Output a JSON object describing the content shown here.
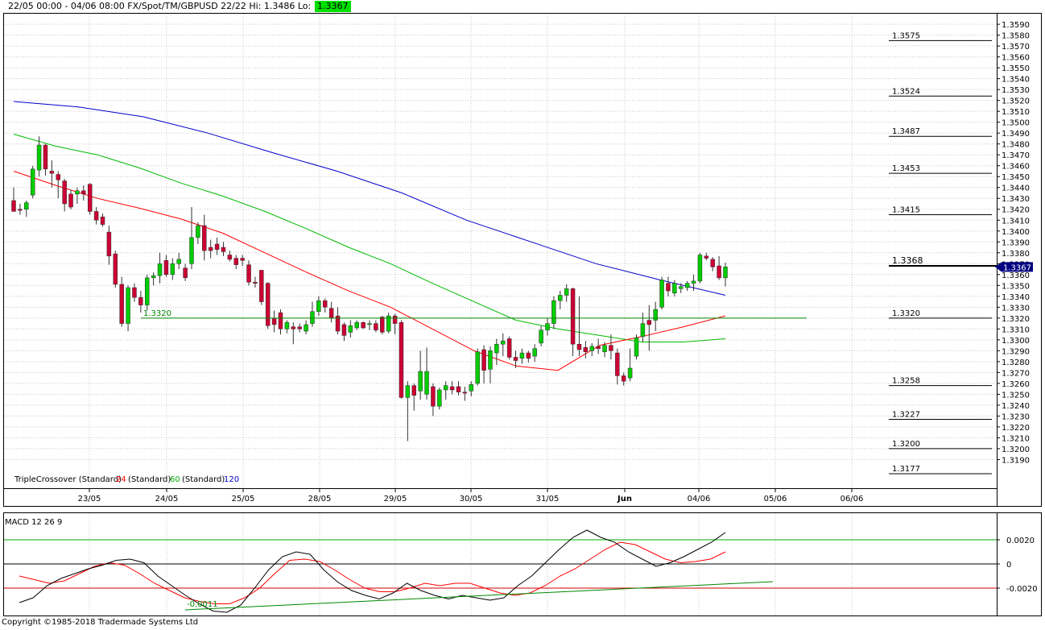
{
  "header": {
    "title": "22/05 00:00 - 04/06 08:00  FX/Spot/TM/GBPUSD 22/22  Hi: 1.3486  Lo: 1.3207",
    "last_price": "1.3367"
  },
  "copyright": "Copyright ©1985-2018 Tradermade Systems Ltd",
  "colors": {
    "bull": "#00cc00",
    "bear": "#cc0033",
    "ma24": "#ff0000",
    "ma60": "#00bb00",
    "ma120": "#0000cc",
    "macd": "#000000",
    "signal": "#ff0000",
    "support": "#008800",
    "pointer": "#000080"
  },
  "chart_data": [
    {
      "type": "candlestick",
      "ylim": [
        1.3177,
        1.3596
      ],
      "yticks": [
        "1.3190",
        "1.3200",
        "1.3210",
        "1.3220",
        "1.3230",
        "1.3240",
        "1.3250",
        "1.3260",
        "1.3270",
        "1.3280",
        "1.3290",
        "1.3300",
        "1.3310",
        "1.3320",
        "1.3330",
        "1.3340",
        "1.3350",
        "1.3360",
        "1.3370",
        "1.3380",
        "1.3390",
        "1.3400",
        "1.3410",
        "1.3420",
        "1.3430",
        "1.3440",
        "1.3450",
        "1.3460",
        "1.3470",
        "1.3480",
        "1.3490",
        "1.3500",
        "1.3510",
        "1.3520",
        "1.3530",
        "1.3540",
        "1.3550",
        "1.3560",
        "1.3570",
        "1.3580",
        "1.3590"
      ],
      "xticks": [
        "23/05",
        "24/05",
        "25/05",
        "28/05",
        "29/05",
        "30/05",
        "31/05",
        "Jun",
        "04/06",
        "05/06",
        "06/06"
      ],
      "legend": {
        "prefix": "TripleCrossover (Standard)",
        "p1": "24",
        "mid1": "(Standard)",
        "p2": "60",
        "mid2": "(Standard)",
        "p3": "120"
      },
      "levels": [
        {
          "label": "1.3575",
          "value": 1.3575
        },
        {
          "label": "1.3524",
          "value": 1.3524
        },
        {
          "label": "1.3487",
          "value": 1.3487
        },
        {
          "label": "1.3453",
          "value": 1.3453
        },
        {
          "label": "1.3415",
          "value": 1.3415
        },
        {
          "label": "1.3368",
          "value": 1.3368
        },
        {
          "label": "1.3320",
          "value": 1.332
        },
        {
          "label": "1.3258",
          "value": 1.3258
        },
        {
          "label": "1.3227",
          "value": 1.3227
        },
        {
          "label": "1.3200",
          "value": 1.32
        },
        {
          "label": "1.3177",
          "value": 1.3177
        }
      ],
      "current_price": {
        "label": "1.3367",
        "value": 1.3367
      },
      "support_line": {
        "label": "1.3320",
        "value": 1.332
      },
      "candles": [
        {
          "o": 1.3428,
          "h": 1.344,
          "l": 1.3418,
          "c": 1.3418
        },
        {
          "o": 1.342,
          "h": 1.3425,
          "l": 1.3415,
          "c": 1.3419
        },
        {
          "o": 1.342,
          "h": 1.3428,
          "l": 1.3413,
          "c": 1.3426
        },
        {
          "o": 1.3433,
          "h": 1.346,
          "l": 1.343,
          "c": 1.3457
        },
        {
          "o": 1.3456,
          "h": 1.3487,
          "l": 1.345,
          "c": 1.3479
        },
        {
          "o": 1.3479,
          "h": 1.348,
          "l": 1.3451,
          "c": 1.3457
        },
        {
          "o": 1.3455,
          "h": 1.3465,
          "l": 1.344,
          "c": 1.3453
        },
        {
          "o": 1.3452,
          "h": 1.3455,
          "l": 1.343,
          "c": 1.3447
        },
        {
          "o": 1.3446,
          "h": 1.3448,
          "l": 1.3418,
          "c": 1.3425
        },
        {
          "o": 1.3434,
          "h": 1.3438,
          "l": 1.342,
          "c": 1.3422
        },
        {
          "o": 1.3434,
          "h": 1.344,
          "l": 1.3425,
          "c": 1.3437
        },
        {
          "o": 1.3437,
          "h": 1.3442,
          "l": 1.3428,
          "c": 1.3434
        },
        {
          "o": 1.3443,
          "h": 1.3444,
          "l": 1.3415,
          "c": 1.3418
        },
        {
          "o": 1.3418,
          "h": 1.3422,
          "l": 1.3406,
          "c": 1.341
        },
        {
          "o": 1.3413,
          "h": 1.3416,
          "l": 1.3404,
          "c": 1.3406
        },
        {
          "o": 1.3399,
          "h": 1.3405,
          "l": 1.3369,
          "c": 1.3377
        },
        {
          "o": 1.3379,
          "h": 1.3382,
          "l": 1.3348,
          "c": 1.3351
        },
        {
          "o": 1.3351,
          "h": 1.3358,
          "l": 1.3312,
          "c": 1.3315
        },
        {
          "o": 1.3315,
          "h": 1.335,
          "l": 1.3308,
          "c": 1.3348
        },
        {
          "o": 1.3348,
          "h": 1.3352,
          "l": 1.3335,
          "c": 1.3339
        },
        {
          "o": 1.3339,
          "h": 1.3345,
          "l": 1.3325,
          "c": 1.3332
        },
        {
          "o": 1.3332,
          "h": 1.336,
          "l": 1.3327,
          "c": 1.3357
        },
        {
          "o": 1.3357,
          "h": 1.3362,
          "l": 1.335,
          "c": 1.3359
        },
        {
          "o": 1.3359,
          "h": 1.338,
          "l": 1.3352,
          "c": 1.337
        },
        {
          "o": 1.3373,
          "h": 1.3378,
          "l": 1.3358,
          "c": 1.336
        },
        {
          "o": 1.336,
          "h": 1.3375,
          "l": 1.3355,
          "c": 1.337
        },
        {
          "o": 1.337,
          "h": 1.338,
          "l": 1.3365,
          "c": 1.3374
        },
        {
          "o": 1.3366,
          "h": 1.337,
          "l": 1.3354,
          "c": 1.3357
        },
        {
          "o": 1.337,
          "h": 1.3422,
          "l": 1.3365,
          "c": 1.3394
        },
        {
          "o": 1.3394,
          "h": 1.3408,
          "l": 1.3388,
          "c": 1.3405
        },
        {
          "o": 1.3405,
          "h": 1.3415,
          "l": 1.3373,
          "c": 1.3382
        },
        {
          "o": 1.3385,
          "h": 1.3392,
          "l": 1.3375,
          "c": 1.3382
        },
        {
          "o": 1.3388,
          "h": 1.3394,
          "l": 1.3378,
          "c": 1.3383
        },
        {
          "o": 1.3385,
          "h": 1.339,
          "l": 1.3377,
          "c": 1.3381
        },
        {
          "o": 1.3378,
          "h": 1.3382,
          "l": 1.3372,
          "c": 1.3374
        },
        {
          "o": 1.3375,
          "h": 1.3378,
          "l": 1.3365,
          "c": 1.3369
        },
        {
          "o": 1.3375,
          "h": 1.3378,
          "l": 1.3368,
          "c": 1.3373
        },
        {
          "o": 1.3369,
          "h": 1.3373,
          "l": 1.335,
          "c": 1.3353
        },
        {
          "o": 1.3353,
          "h": 1.3358,
          "l": 1.3348,
          "c": 1.3352
        },
        {
          "o": 1.3364,
          "h": 1.3364,
          "l": 1.3332,
          "c": 1.3335
        },
        {
          "o": 1.3352,
          "h": 1.3353,
          "l": 1.331,
          "c": 1.3313
        },
        {
          "o": 1.332,
          "h": 1.3327,
          "l": 1.3307,
          "c": 1.3314
        },
        {
          "o": 1.3325,
          "h": 1.3328,
          "l": 1.3305,
          "c": 1.331
        },
        {
          "o": 1.331,
          "h": 1.3318,
          "l": 1.3306,
          "c": 1.3316
        },
        {
          "o": 1.3312,
          "h": 1.3316,
          "l": 1.3296,
          "c": 1.331
        },
        {
          "o": 1.3312,
          "h": 1.3315,
          "l": 1.3307,
          "c": 1.331
        },
        {
          "o": 1.3308,
          "h": 1.3318,
          "l": 1.3305,
          "c": 1.3314
        },
        {
          "o": 1.3315,
          "h": 1.3335,
          "l": 1.3312,
          "c": 1.3326
        },
        {
          "o": 1.3326,
          "h": 1.334,
          "l": 1.3322,
          "c": 1.3336
        },
        {
          "o": 1.3336,
          "h": 1.3338,
          "l": 1.3325,
          "c": 1.333
        },
        {
          "o": 1.3329,
          "h": 1.3335,
          "l": 1.3316,
          "c": 1.332
        },
        {
          "o": 1.3322,
          "h": 1.333,
          "l": 1.3305,
          "c": 1.3308
        },
        {
          "o": 1.3314,
          "h": 1.3316,
          "l": 1.3299,
          "c": 1.3304
        },
        {
          "o": 1.3307,
          "h": 1.3318,
          "l": 1.3302,
          "c": 1.3313
        },
        {
          "o": 1.3311,
          "h": 1.3318,
          "l": 1.3309,
          "c": 1.3316
        },
        {
          "o": 1.3316,
          "h": 1.3317,
          "l": 1.331,
          "c": 1.3311
        },
        {
          "o": 1.3314,
          "h": 1.3318,
          "l": 1.3309,
          "c": 1.3315
        },
        {
          "o": 1.3315,
          "h": 1.3318,
          "l": 1.3307,
          "c": 1.3309
        },
        {
          "o": 1.3321,
          "h": 1.3322,
          "l": 1.3305,
          "c": 1.3307
        },
        {
          "o": 1.3308,
          "h": 1.3325,
          "l": 1.3306,
          "c": 1.3322
        },
        {
          "o": 1.3322,
          "h": 1.3324,
          "l": 1.3305,
          "c": 1.3315
        },
        {
          "o": 1.3316,
          "h": 1.3318,
          "l": 1.3246,
          "c": 1.3247
        },
        {
          "o": 1.3247,
          "h": 1.3262,
          "l": 1.3207,
          "c": 1.3258
        },
        {
          "o": 1.3258,
          "h": 1.326,
          "l": 1.3235,
          "c": 1.3249
        },
        {
          "o": 1.3253,
          "h": 1.329,
          "l": 1.3245,
          "c": 1.3271
        },
        {
          "o": 1.325,
          "h": 1.3293,
          "l": 1.3245,
          "c": 1.3271
        },
        {
          "o": 1.3257,
          "h": 1.326,
          "l": 1.323,
          "c": 1.3239
        },
        {
          "o": 1.3239,
          "h": 1.3256,
          "l": 1.3236,
          "c": 1.3254
        },
        {
          "o": 1.3254,
          "h": 1.3262,
          "l": 1.3245,
          "c": 1.3258
        },
        {
          "o": 1.3257,
          "h": 1.3262,
          "l": 1.325,
          "c": 1.3254
        },
        {
          "o": 1.3257,
          "h": 1.3262,
          "l": 1.3249,
          "c": 1.3252
        },
        {
          "o": 1.3252,
          "h": 1.3257,
          "l": 1.3244,
          "c": 1.3251
        },
        {
          "o": 1.3253,
          "h": 1.3262,
          "l": 1.3248,
          "c": 1.3259
        },
        {
          "o": 1.326,
          "h": 1.3292,
          "l": 1.3258,
          "c": 1.3289
        },
        {
          "o": 1.3291,
          "h": 1.3295,
          "l": 1.326,
          "c": 1.3272
        },
        {
          "o": 1.3273,
          "h": 1.3294,
          "l": 1.326,
          "c": 1.329
        },
        {
          "o": 1.3288,
          "h": 1.3301,
          "l": 1.3277,
          "c": 1.3296
        },
        {
          "o": 1.3296,
          "h": 1.3306,
          "l": 1.3285,
          "c": 1.3299
        },
        {
          "o": 1.3301,
          "h": 1.3303,
          "l": 1.3282,
          "c": 1.3284
        },
        {
          "o": 1.3284,
          "h": 1.329,
          "l": 1.3274,
          "c": 1.3281
        },
        {
          "o": 1.3283,
          "h": 1.3292,
          "l": 1.3278,
          "c": 1.3288
        },
        {
          "o": 1.3288,
          "h": 1.329,
          "l": 1.3279,
          "c": 1.3283
        },
        {
          "o": 1.3285,
          "h": 1.3296,
          "l": 1.328,
          "c": 1.3292
        },
        {
          "o": 1.3297,
          "h": 1.3313,
          "l": 1.3294,
          "c": 1.3309
        },
        {
          "o": 1.3309,
          "h": 1.332,
          "l": 1.3304,
          "c": 1.3315
        },
        {
          "o": 1.3315,
          "h": 1.334,
          "l": 1.331,
          "c": 1.3336
        },
        {
          "o": 1.3336,
          "h": 1.3345,
          "l": 1.3328,
          "c": 1.3341
        },
        {
          "o": 1.3341,
          "h": 1.3351,
          "l": 1.3335,
          "c": 1.3347
        },
        {
          "o": 1.3347,
          "h": 1.3348,
          "l": 1.3285,
          "c": 1.3296
        },
        {
          "o": 1.3296,
          "h": 1.334,
          "l": 1.3285,
          "c": 1.3291
        },
        {
          "o": 1.3293,
          "h": 1.3299,
          "l": 1.3283,
          "c": 1.3289
        },
        {
          "o": 1.329,
          "h": 1.3297,
          "l": 1.3285,
          "c": 1.3294
        },
        {
          "o": 1.3294,
          "h": 1.3301,
          "l": 1.3287,
          "c": 1.3292
        },
        {
          "o": 1.3289,
          "h": 1.3298,
          "l": 1.3284,
          "c": 1.3295
        },
        {
          "o": 1.3295,
          "h": 1.3305,
          "l": 1.3282,
          "c": 1.329
        },
        {
          "o": 1.3288,
          "h": 1.3292,
          "l": 1.3259,
          "c": 1.3267
        },
        {
          "o": 1.3267,
          "h": 1.327,
          "l": 1.3258,
          "c": 1.3262
        },
        {
          "o": 1.3265,
          "h": 1.3292,
          "l": 1.3262,
          "c": 1.3274
        },
        {
          "o": 1.3285,
          "h": 1.3305,
          "l": 1.3282,
          "c": 1.3302
        },
        {
          "o": 1.3303,
          "h": 1.3325,
          "l": 1.3298,
          "c": 1.3315
        },
        {
          "o": 1.3318,
          "h": 1.3332,
          "l": 1.329,
          "c": 1.3314
        },
        {
          "o": 1.3318,
          "h": 1.3335,
          "l": 1.3308,
          "c": 1.3328
        },
        {
          "o": 1.333,
          "h": 1.3358,
          "l": 1.3328,
          "c": 1.3355
        },
        {
          "o": 1.3352,
          "h": 1.3358,
          "l": 1.334,
          "c": 1.3345
        },
        {
          "o": 1.3343,
          "h": 1.3355,
          "l": 1.334,
          "c": 1.3352
        },
        {
          "o": 1.3347,
          "h": 1.3352,
          "l": 1.3343,
          "c": 1.3349
        },
        {
          "o": 1.3348,
          "h": 1.3354,
          "l": 1.3345,
          "c": 1.3352
        },
        {
          "o": 1.3352,
          "h": 1.336,
          "l": 1.3345,
          "c": 1.3354
        },
        {
          "o": 1.3354,
          "h": 1.338,
          "l": 1.3352,
          "c": 1.3378
        },
        {
          "o": 1.3377,
          "h": 1.338,
          "l": 1.3373,
          "c": 1.3375
        },
        {
          "o": 1.3374,
          "h": 1.3376,
          "l": 1.3363,
          "c": 1.3367
        },
        {
          "o": 1.3368,
          "h": 1.3377,
          "l": 1.3355,
          "c": 1.3357
        },
        {
          "o": 1.3357,
          "h": 1.3371,
          "l": 1.3349,
          "c": 1.3367
        }
      ],
      "ma24": [
        1.3455,
        1.3442,
        1.343,
        1.3421,
        1.3411,
        1.3398,
        1.338,
        1.3362,
        1.3345,
        1.333,
        1.331,
        1.329,
        1.3276,
        1.3272,
        1.3295,
        1.3303,
        1.3312,
        1.3322
      ],
      "ma60": [
        1.3489,
        1.3478,
        1.347,
        1.3458,
        1.3444,
        1.3432,
        1.3418,
        1.3402,
        1.3385,
        1.337,
        1.3352,
        1.3335,
        1.3318,
        1.331,
        1.3304,
        1.3298,
        1.3298,
        1.3301
      ],
      "ma120": [
        1.3519,
        1.3514,
        1.3505,
        1.349,
        1.3472,
        1.3455,
        1.3435,
        1.341,
        1.339,
        1.337,
        1.3355,
        1.3341
      ]
    },
    {
      "type": "line",
      "title": "MACD 12 26 9",
      "ylim": [
        -0.004,
        0.004
      ],
      "yticks": [
        "0.0020",
        "0",
        "-0.0020"
      ],
      "upper_level": 0.002,
      "lower_level": -0.002,
      "min_label": "-0.0011",
      "series": [
        {
          "values": [
            -0.0032,
            -0.0028,
            -0.0018,
            -0.0012,
            -0.0008,
            -0.0004,
            -0.0001,
            0.0003,
            0.0004,
            0.0001,
            -0.001,
            -0.0018,
            -0.0026,
            -0.0033,
            -0.0039,
            -0.004,
            -0.0034,
            -0.002,
            -0.0005,
            0.0006,
            0.001,
            0.0008,
            -0.0005,
            -0.0015,
            -0.0022,
            -0.0026,
            -0.0029,
            -0.0024,
            -0.0016,
            -0.0022,
            -0.0026,
            -0.0029,
            -0.0026,
            -0.0028,
            -0.003,
            -0.0028,
            -0.0018,
            -0.001,
            0.0001,
            0.0012,
            0.0022,
            0.0028,
            0.0022,
            0.0018,
            0.001,
            0.0004,
            -0.0002,
            0.0001,
            0.0006,
            0.0012,
            0.0018,
            0.0026
          ]
        },
        {
          "values": [
            -0.001,
            -0.0013,
            -0.0016,
            -0.0014,
            -0.0008,
            -0.0002,
            0.0001,
            -0.0001,
            -0.0008,
            -0.0016,
            -0.0022,
            -0.0028,
            -0.0031,
            -0.0033,
            -0.0033,
            -0.0028,
            -0.002,
            -0.0008,
            0.0003,
            0.0004,
            0.0002,
            -0.0005,
            -0.0013,
            -0.002,
            -0.0023,
            -0.0023,
            -0.002,
            -0.0016,
            -0.0018,
            -0.0016,
            -0.0016,
            -0.002,
            -0.0024,
            -0.0026,
            -0.0024,
            -0.0018,
            -0.001,
            -0.0004,
            0.0004,
            0.0012,
            0.0018,
            0.0016,
            0.001,
            0.0004,
            0.0001,
            0.0002,
            0.0004,
            0.001
          ]
        }
      ]
    }
  ]
}
